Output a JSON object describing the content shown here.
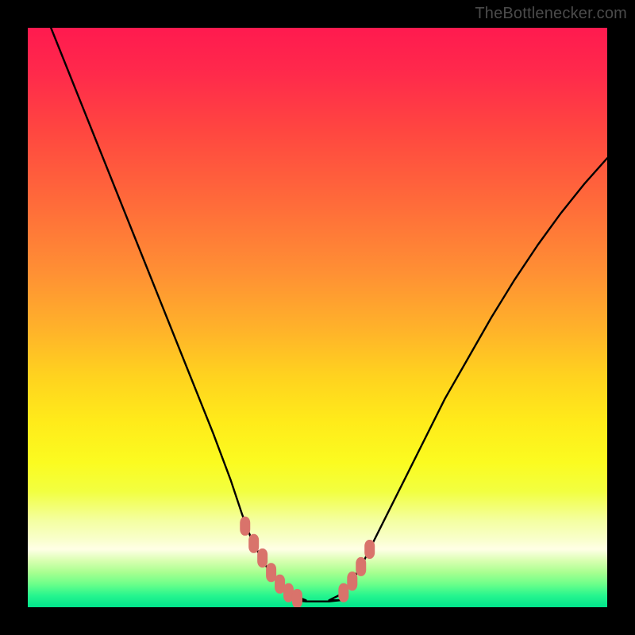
{
  "watermark": "TheBottlenecker.com",
  "colors": {
    "frame": "#000000",
    "curve": "#000000",
    "markers": "#D9736B",
    "gradient_top": "#FF1A4F",
    "gradient_bottom": "#00E48C"
  },
  "chart_data": {
    "type": "line",
    "title": "",
    "xlabel": "",
    "ylabel": "",
    "xlim": [
      0,
      100
    ],
    "ylim": [
      0,
      100
    ],
    "grid": false,
    "note": "Chart has no visible axes, tick labels, or numeric annotations. Values below are pixel-space estimates (0–100 each axis, y=0 at bottom). The two black curves form a V shape; the salmon markers cluster near the valley floor.",
    "series": [
      {
        "name": "left-curve",
        "x": [
          4,
          8,
          12,
          16,
          20,
          24,
          28,
          32,
          35,
          37,
          38.5,
          40,
          41.5,
          43,
          44.5,
          46,
          48
        ],
        "y": [
          100,
          90,
          80,
          70,
          60,
          50,
          40,
          30,
          22,
          16,
          12,
          9,
          6.5,
          4.5,
          3,
          2,
          1.2
        ]
      },
      {
        "name": "valley-floor",
        "x": [
          46,
          48,
          50,
          52,
          54
        ],
        "y": [
          1.2,
          1.0,
          1.0,
          1.0,
          1.2
        ]
      },
      {
        "name": "right-curve",
        "x": [
          52,
          54,
          56,
          58,
          60,
          64,
          68,
          72,
          76,
          80,
          84,
          88,
          92,
          96,
          100
        ],
        "y": [
          1.2,
          2.2,
          4.5,
          8,
          12,
          20,
          28,
          36,
          43,
          50,
          56.5,
          62.5,
          68,
          73,
          77.5
        ]
      },
      {
        "name": "left-markers",
        "type": "scatter",
        "x": [
          37.5,
          39,
          40.5,
          42,
          43.5,
          45,
          46.5
        ],
        "y": [
          14,
          11,
          8.5,
          6,
          4,
          2.5,
          1.5
        ]
      },
      {
        "name": "right-markers",
        "type": "scatter",
        "x": [
          54.5,
          56,
          57.5,
          59
        ],
        "y": [
          2.5,
          4.5,
          7,
          10
        ]
      }
    ]
  }
}
